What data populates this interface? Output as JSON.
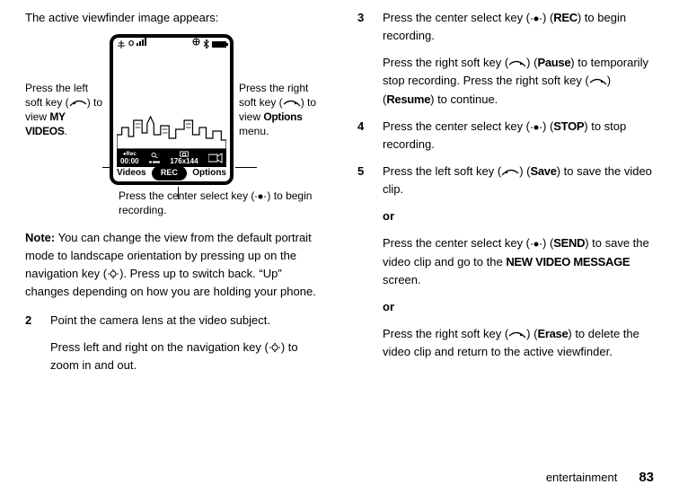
{
  "left": {
    "intro": "The active viewfinder image appears:",
    "callout_left_a": "Press the left soft key (",
    "callout_left_b": ") to view ",
    "callout_left_label": "MY VIDEOS",
    "callout_left_c": ".",
    "callout_right_a": "Press the right soft key (",
    "callout_right_b": ") to view ",
    "callout_right_label": "Options",
    "callout_right_c": " menu.",
    "callout_center_a": "Press the center select key (",
    "callout_center_b": ") to begin recording.",
    "note_label": "Note:",
    "note_body": " You can change the view from the default portrait mode to landscape orientation by pressing up on the navigation key (",
    "note_body2": "). Press up to switch back. “Up” changes depending on how you are holding your phone.",
    "step2_num": "2",
    "step2_p1": "Point the camera lens at the video subject.",
    "step2_p2a": "Press left and right on the navigation key (",
    "step2_p2b": ") to zoom in and out."
  },
  "right": {
    "step3_num": "3",
    "step3_p1a": "Press the center select key (",
    "step3_p1b": ") (",
    "step3_p1c": ") to begin recording.",
    "step3_label_rec": "REC",
    "step3_p2a": "Press the right soft key (",
    "step3_p2b": ") (",
    "step3_p2c": ") to temporarily stop recording. Press the right soft key (",
    "step3_p2d": ") (",
    "step3_p2e": ") to continue.",
    "step3_label_pause": "Pause",
    "step3_label_resume": "Resume",
    "step4_num": "4",
    "step4_a": "Press the center select key (",
    "step4_b": ") (",
    "step4_c": ") to stop recording.",
    "step4_label_stop": "STOP",
    "step5_num": "5",
    "step5_a": "Press the left soft key (",
    "step5_b": ") (",
    "step5_c": ") to save the video clip.",
    "step5_label_save": "Save",
    "or1": "or",
    "step5_d": "Press the center select key (",
    "step5_e": ") (",
    "step5_f": ") to save the video clip and go to the ",
    "step5_label_send": "SEND",
    "step5_label_nvm": "NEW VIDEO MESSAGE",
    "step5_g": " screen.",
    "or2": "or",
    "step5_h": "Press the right soft key (",
    "step5_i": ") (",
    "step5_j": ") to delete the video clip and return to the active viewfinder.",
    "step5_label_erase": "Erase"
  },
  "phone": {
    "rec_tag": "●Rec",
    "time": "00:00",
    "res": "176x144",
    "soft_left": "Videos",
    "soft_center": "REC",
    "soft_right": "Options",
    "sig_label": "O"
  },
  "footer": {
    "section": "entertainment",
    "page": "83"
  }
}
